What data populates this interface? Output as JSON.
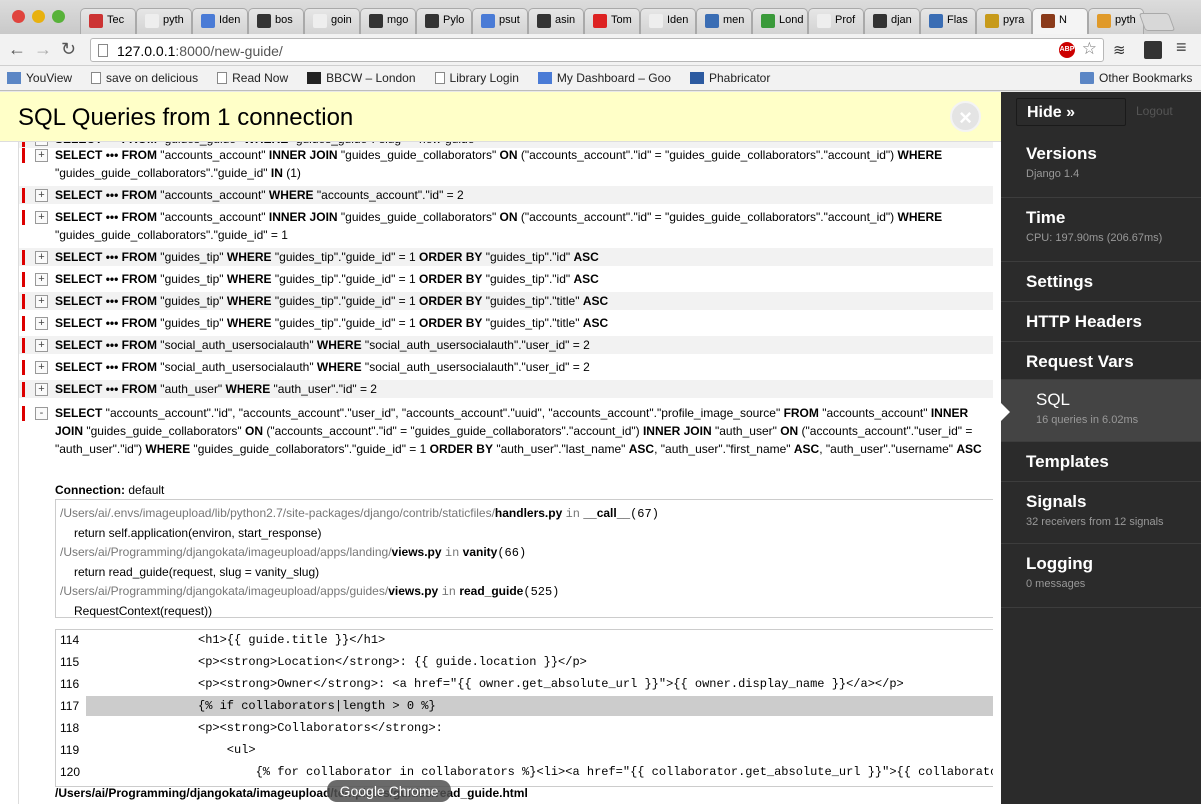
{
  "browser": {
    "tabs": [
      {
        "label": "Tec",
        "color": "#c33"
      },
      {
        "label": "pyth",
        "color": "#eee"
      },
      {
        "label": "Iden",
        "color": "#4a7bd6"
      },
      {
        "label": "bos",
        "color": "#333"
      },
      {
        "label": "goin",
        "color": "#eee"
      },
      {
        "label": "mgo",
        "color": "#333"
      },
      {
        "label": "Pylo",
        "color": "#333"
      },
      {
        "label": "psut",
        "color": "#4a7bd6"
      },
      {
        "label": "asin",
        "color": "#333"
      },
      {
        "label": "Tom",
        "color": "#d22"
      },
      {
        "label": "Iden",
        "color": "#eee"
      },
      {
        "label": "men",
        "color": "#3a6db4"
      },
      {
        "label": "Lond",
        "color": "#3a9a3a"
      },
      {
        "label": "Prof",
        "color": "#eee"
      },
      {
        "label": "djan",
        "color": "#333"
      },
      {
        "label": "Flas",
        "color": "#3a6db4"
      },
      {
        "label": "pyra",
        "color": "#c79a1a"
      },
      {
        "label": "N",
        "color": "#8a3a1a"
      },
      {
        "label": "pyth",
        "color": "#e09a2a"
      }
    ],
    "url_host": "127.0.0.1",
    "url_rest": ":8000/new-guide/",
    "bookmarks": [
      {
        "label": "YouView",
        "icon": "folder-icon"
      },
      {
        "label": "save on delicious",
        "icon": "page-icon"
      },
      {
        "label": "Read Now",
        "icon": "page-icon"
      },
      {
        "label": "BBCW – London",
        "icon": "bbc-icon"
      },
      {
        "label": "Library Login",
        "icon": "page-icon"
      },
      {
        "label": "My Dashboard – Goo",
        "icon": "google-icon"
      },
      {
        "label": "Phabricator",
        "icon": "phabricator-icon"
      }
    ],
    "other_bookmarks": "Other Bookmarks",
    "tooltip": "Google Chrome"
  },
  "panel": {
    "title": "SQL Queries from 1 connection",
    "close_symbol": "×"
  },
  "queries": [
    {
      "text": "SELECT ••• FROM \"guides_guide\" WHERE \"guides_guide\".\"slug\" = new-guide",
      "toggle": "+"
    },
    {
      "text": "SELECT ••• FROM \"accounts_account\" INNER JOIN \"guides_guide_collaborators\" ON (\"accounts_account\".\"id\" = \"guides_guide_collaborators\".\"account_id\") WHERE \"guides_guide_collaborators\".\"guide_id\" IN (1)",
      "toggle": "+"
    },
    {
      "text": "SELECT ••• FROM \"accounts_account\" WHERE \"accounts_account\".\"id\" = 2",
      "toggle": "+"
    },
    {
      "text": "SELECT ••• FROM \"accounts_account\" INNER JOIN \"guides_guide_collaborators\" ON (\"accounts_account\".\"id\" = \"guides_guide_collaborators\".\"account_id\") WHERE \"guides_guide_collaborators\".\"guide_id\" = 1",
      "toggle": "+"
    },
    {
      "text": "SELECT ••• FROM \"guides_tip\" WHERE \"guides_tip\".\"guide_id\" = 1 ORDER BY \"guides_tip\".\"id\" ASC",
      "toggle": "+"
    },
    {
      "text": "SELECT ••• FROM \"guides_tip\" WHERE \"guides_tip\".\"guide_id\" = 1 ORDER BY \"guides_tip\".\"id\" ASC",
      "toggle": "+"
    },
    {
      "text": "SELECT ••• FROM \"guides_tip\" WHERE \"guides_tip\".\"guide_id\" = 1 ORDER BY \"guides_tip\".\"title\" ASC",
      "toggle": "+"
    },
    {
      "text": "SELECT ••• FROM \"guides_tip\" WHERE \"guides_tip\".\"guide_id\" = 1 ORDER BY \"guides_tip\".\"title\" ASC",
      "toggle": "+"
    },
    {
      "text": "SELECT ••• FROM \"social_auth_usersocialauth\" WHERE \"social_auth_usersocialauth\".\"user_id\" = 2",
      "toggle": "+"
    },
    {
      "text": "SELECT ••• FROM \"social_auth_usersocialauth\" WHERE \"social_auth_usersocialauth\".\"user_id\" = 2",
      "toggle": "+"
    },
    {
      "text": "SELECT ••• FROM \"auth_user\" WHERE \"auth_user\".\"id\" = 2",
      "toggle": "+"
    },
    {
      "text": "SELECT \"accounts_account\".\"id\", \"accounts_account\".\"user_id\", \"accounts_account\".\"uuid\", \"accounts_account\".\"profile_image_source\" FROM \"accounts_account\" INNER JOIN \"guides_guide_collaborators\" ON (\"accounts_account\".\"id\" = \"guides_guide_collaborators\".\"account_id\") INNER JOIN \"auth_user\" ON (\"accounts_account\".\"user_id\" = \"auth_user\".\"id\") WHERE \"guides_guide_collaborators\".\"guide_id\" = 1 ORDER BY \"auth_user\".\"last_name\" ASC, \"auth_user\".\"first_name\" ASC, \"auth_user\".\"username\" ASC",
      "toggle": "-"
    }
  ],
  "connection": {
    "label": "Connection:",
    "value": "default"
  },
  "stacktrace": [
    {
      "path": "/Users/ai/.envs/imageupload/lib/python2.7/site-packages/django/contrib/staticfiles/",
      "file": "handlers.py",
      "in": "in",
      "func": "__call__",
      "line": "67",
      "code": "return self.application(environ, start_response)"
    },
    {
      "path": "/Users/ai/Programming/djangokata/imageupload/apps/landing/",
      "file": "views.py",
      "in": "in",
      "func": "vanity",
      "line": "66",
      "code": "return read_guide(request, slug = vanity_slug)"
    },
    {
      "path": "/Users/ai/Programming/djangokata/imageupload/apps/guides/",
      "file": "views.py",
      "in": "in",
      "func": "read_guide",
      "line": "525",
      "code": "RequestContext(request))"
    }
  ],
  "template_lines": [
    {
      "num": "114",
      "code": "<h1>{{ guide.title }}</h1>"
    },
    {
      "num": "115",
      "code": "<p><strong>Location</strong>: {{ guide.location }}</p>"
    },
    {
      "num": "116",
      "code": "<p><strong>Owner</strong>: <a href=\"{{ owner.get_absolute_url }}\">{{ owner.display_name }}</a></p>"
    },
    {
      "num": "117",
      "code": "{% if collaborators|length > 0 %}"
    },
    {
      "num": "118",
      "code": "<p><strong>Collaborators</strong>:"
    },
    {
      "num": "119",
      "code": "    <ul>"
    },
    {
      "num": "120",
      "code": "        {% for collaborator in collaborators %}<li><a href=\"{{ collaborator.get_absolute_url }}\">{{ collaborator.display_name }}"
    }
  ],
  "template_path": "/Users/ai/Programming/djangokata/imageupload/templates/guides/read_guide.html",
  "sidebar": {
    "hide": "Hide »",
    "logout": "Logout",
    "items": [
      {
        "title": "Versions",
        "sub": "Django 1.4"
      },
      {
        "title": "Time",
        "sub": "CPU: 197.90ms (206.67ms)"
      },
      {
        "title": "Settings",
        "sub": ""
      },
      {
        "title": "HTTP Headers",
        "sub": ""
      },
      {
        "title": "Request Vars",
        "sub": ""
      },
      {
        "title": "SQL",
        "sub": "16 queries in 6.02ms"
      },
      {
        "title": "Templates",
        "sub": ""
      },
      {
        "title": "Signals",
        "sub": "32 receivers from 12 signals"
      },
      {
        "title": "Logging",
        "sub": "0 messages"
      }
    ]
  }
}
